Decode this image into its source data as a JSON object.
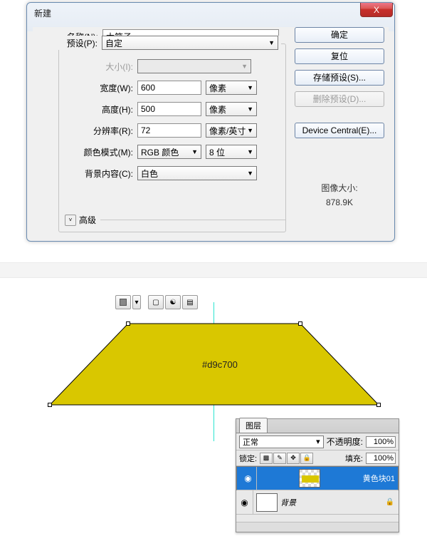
{
  "dialog": {
    "title": "新建",
    "name_label": "名称(N):",
    "name_value": "木箱子",
    "preset_label": "预设(P):",
    "preset_value": "自定",
    "size_label": "大小(I):",
    "width_label": "宽度(W):",
    "width_value": "600",
    "width_unit": "像素",
    "height_label": "高度(H):",
    "height_value": "500",
    "height_unit": "像素",
    "res_label": "分辨率(R):",
    "res_value": "72",
    "res_unit": "像素/英寸",
    "mode_label": "颜色模式(M):",
    "mode_value": "RGB 颜色",
    "bit_value": "8 位",
    "bg_label": "背景内容(C):",
    "bg_value": "白色",
    "advanced": "高级",
    "buttons": {
      "ok": "确定",
      "reset": "复位",
      "save_preset": "存储预设(S)...",
      "delete_preset": "删除预设(D)...",
      "device_central": "Device Central(E)..."
    },
    "info_label": "图像大小:",
    "info_value": "878.9K",
    "close_x": "X"
  },
  "shape": {
    "color_label": "#d9c700",
    "fill_color": "#d9c700"
  },
  "layers": {
    "tab": "图层",
    "blend": "正常",
    "opacity_label": "不透明度:",
    "opacity_value": "100%",
    "lock_label": "锁定:",
    "fill_label": "填充:",
    "fill_value": "100%",
    "items": [
      {
        "name": "黄色块01"
      },
      {
        "name": "背景"
      }
    ]
  }
}
